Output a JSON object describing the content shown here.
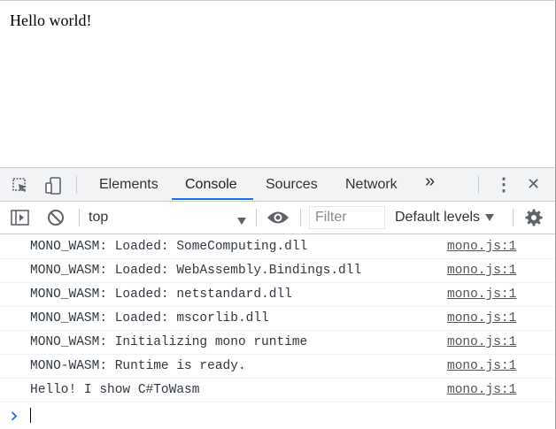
{
  "page": {
    "text": "Hello world!"
  },
  "devtools": {
    "tabs": [
      "Elements",
      "Console",
      "Sources",
      "Network"
    ],
    "active_tab": "Console",
    "more_tabs_glyph": "»",
    "kebab_glyph": "⋮",
    "close_glyph": "✕"
  },
  "toolbar": {
    "context": "top",
    "filter_placeholder": "Filter",
    "levels_label": "Default levels"
  },
  "console": {
    "messages": [
      {
        "text": "MONO_WASM: Loaded: SomeComputing.dll",
        "source": "mono.js:1"
      },
      {
        "text": "MONO_WASM: Loaded: WebAssembly.Bindings.dll",
        "source": "mono.js:1"
      },
      {
        "text": "MONO_WASM: Loaded: netstandard.dll",
        "source": "mono.js:1"
      },
      {
        "text": "MONO_WASM: Loaded: mscorlib.dll",
        "source": "mono.js:1"
      },
      {
        "text": "MONO_WASM: Initializing mono runtime",
        "source": "mono.js:1"
      },
      {
        "text": "MONO-WASM: Runtime is ready.",
        "source": "mono.js:1"
      },
      {
        "text": "Hello! I show C#ToWasm",
        "source": "mono.js:1"
      }
    ]
  },
  "icons": {
    "inspect": "inspect-element-icon",
    "device": "device-toolbar-icon",
    "sidebar": "console-sidebar-icon",
    "clear": "clear-console-icon",
    "eye": "live-expression-eye-icon",
    "settings": "settings-gear-icon",
    "prompt": "prompt-chevron-icon"
  },
  "colors": {
    "accent": "#1a73e8",
    "tabbar_bg": "#f1f3f4"
  }
}
